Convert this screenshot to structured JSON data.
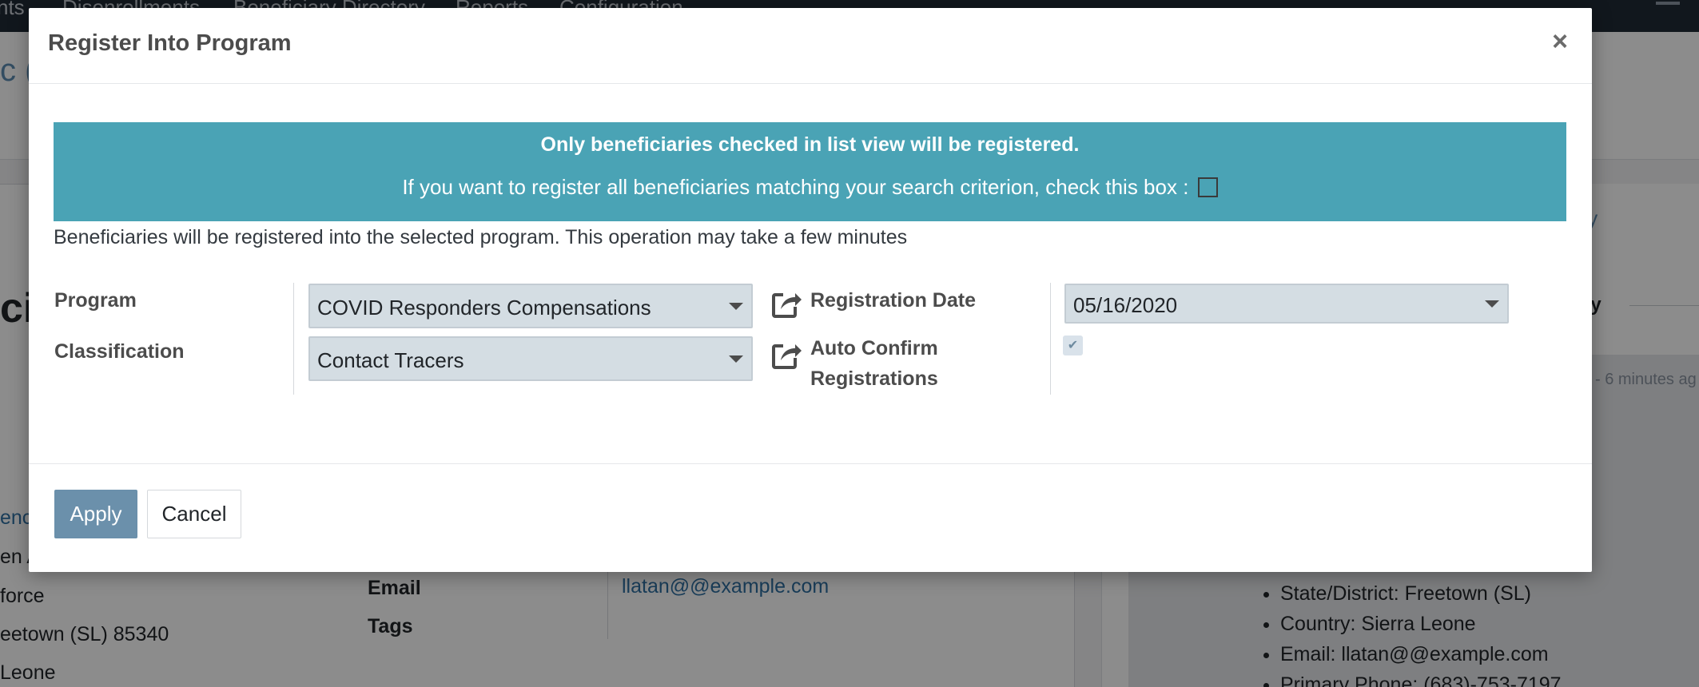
{
  "background": {
    "nav_items": [
      "nts",
      "Disenrollments",
      "Beneficiary Directory",
      "Reports",
      "Configuration"
    ],
    "record_title": "c (C",
    "big_title": "ci",
    "chatter_label": "ty",
    "day_label": "ay",
    "ago": "- 6 minutes ag",
    "left_lines": [
      "enc",
      "en A",
      "force",
      "eetown (SL) 85340",
      "Leone"
    ],
    "labels": {
      "email": "Email",
      "tags": "Tags"
    },
    "email_value": "llatan@@example.com",
    "bullets": [
      "State/District: Freetown (SL)",
      "Country: Sierra Leone",
      "Email: llatan@@example.com",
      "Primary Phone: (683)-753-7197"
    ]
  },
  "modal": {
    "title": "Register Into Program",
    "close_glyph": "×",
    "alert": {
      "line1": "Only beneficiaries checked in list view will be registered.",
      "line2": "If you want to register all beneficiaries matching your search criterion, check this box :",
      "checked": false
    },
    "description": "Beneficiaries will be registered into the selected program. This operation may take a few minutes",
    "fields": {
      "program": {
        "label": "Program",
        "value": "COVID Responders Compensations"
      },
      "classification": {
        "label": "Classification",
        "value": "Contact Tracers"
      },
      "registration_date": {
        "label": "Registration Date",
        "value": "05/16/2020"
      },
      "auto_confirm": {
        "label_line1": "Auto Confirm",
        "label_line2": "Registrations",
        "checked": true,
        "check_glyph": "✔"
      }
    },
    "buttons": {
      "apply": "Apply",
      "cancel": "Cancel"
    },
    "colors": {
      "alert": "#4aa3b5",
      "apply": "#6b90ab",
      "select_bg": "#d4dde3"
    },
    "icons": {
      "external": "external-link-icon",
      "close": "close-icon",
      "caret": "caret-down-icon"
    }
  }
}
